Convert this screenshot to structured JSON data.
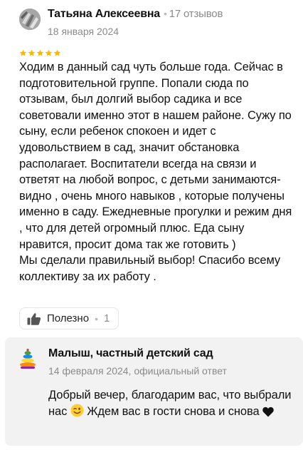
{
  "review": {
    "author": "Татьяна Алексеевна",
    "review_count": "17 отзывов",
    "date": "18 января 2024",
    "rating": 5,
    "text": "Ходим в данный сад чуть больше года. Сейчас в подготовительной группе. Попали сюда по отзывам, был долгий выбор садика и все советовали именно этот в нашем районе. Сужу по сыну, если ребенок спокоен и идет с удовольствием в сад, значит обстановка располагает. Воспитатели всегда на связи и ответят на любой вопрос, с детьми занимаются-видно , очень много навыков , которые получены именно в саду. Ежедневные прогулки и режим дня , что для детей огромный плюс. Еда сыну нравится, просит дома так же готовить )\nМы сделали правильный выбор! Спасибо всему коллективу за их работу .",
    "helpful_label": "Полезно",
    "helpful_count": "1"
  },
  "answer": {
    "organization": "Малыш, частный детский сад",
    "date_and_type": "14 февраля 2024, официальный ответ",
    "text_part1": "Добрый вечер, благодарим вас, что выбрали нас",
    "text_part2": "Ждем вас в гости снова и снова"
  },
  "icons": {
    "avatar": "user-avatar",
    "star": "star-icon",
    "like": "thumbs-up-icon",
    "org_logo": "pyramid-toy-logo",
    "emoji_smile": "winking-face-emoji",
    "emoji_heart": "black-heart-emoji"
  },
  "colors": {
    "star": "#ffb800",
    "secondary_text": "#8a8a8a",
    "answer_bg": "#f2f2f2"
  }
}
